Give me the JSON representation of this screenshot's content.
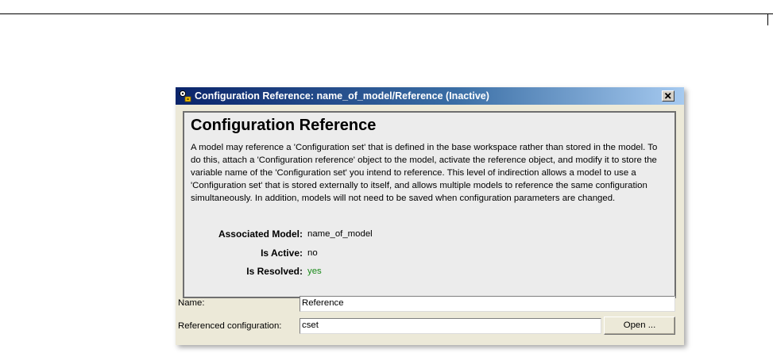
{
  "window": {
    "title": "Configuration Reference: name_of_model/Reference (Inactive)",
    "icon": "simulink-config-icon",
    "close_icon": "close-icon"
  },
  "description": {
    "heading": "Configuration Reference",
    "text": "A model may reference a 'Configuration set' that is defined in the base workspace rather than stored in the model. To do this, attach a 'Configuration reference' object to the model, activate the reference object, and modify it to store the variable name of the 'Configuration set' you intend to reference. This level of indirection allows a model to use a 'Configuration set' that is stored externally to itself, and allows multiple models to reference the same configuration simultaneously. In addition, models will not need to be saved when configuration parameters are changed."
  },
  "properties": [
    {
      "label": "Associated Model:",
      "value": "name_of_model"
    },
    {
      "label": "Is Active:",
      "value": "no"
    },
    {
      "label": "Is Resolved:",
      "value": "yes"
    }
  ],
  "colors": {
    "resolved_value": "#1a8a1a",
    "titlebar_start": "#0a246a",
    "titlebar_end": "#a6caf0"
  },
  "form": {
    "name_label": "Name:",
    "name_value": "Reference",
    "refconfig_label": "Referenced configuration:",
    "refconfig_value": "cset",
    "open_button": "Open ..."
  }
}
